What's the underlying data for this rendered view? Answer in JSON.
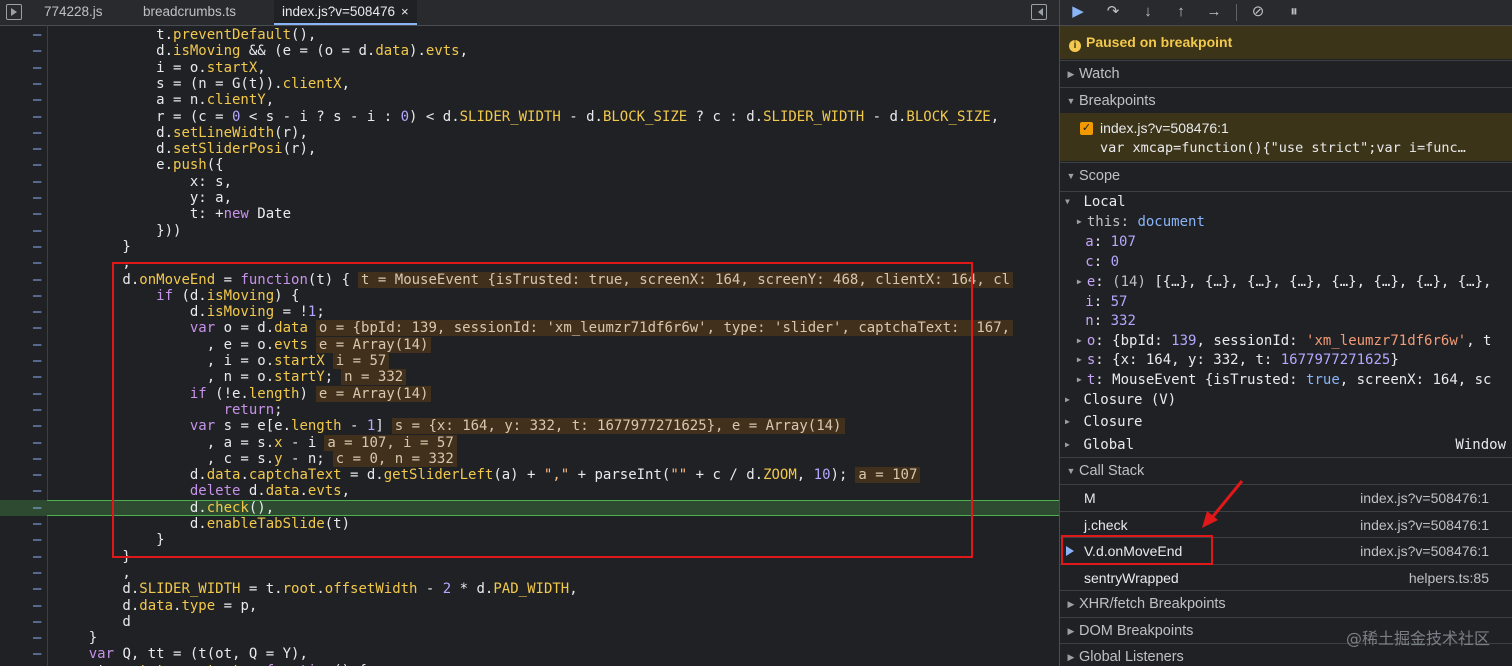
{
  "tabs": [
    {
      "label": "774228.js",
      "active": false
    },
    {
      "label": "breadcrumbs.ts",
      "active": false
    },
    {
      "label": "index.js?v=508476",
      "active": true
    }
  ],
  "tab_close": "×",
  "code_lines": [
    {
      "t": "            t.preventDefault(),"
    },
    {
      "t": "            d.isMoving && (e = (o = d.data).evts,"
    },
    {
      "t": "            i = o.startX,"
    },
    {
      "t": "            s = (n = G(t)).clientX,"
    },
    {
      "t": "            a = n.clientY,"
    },
    {
      "t": "            r = (c = 0 < s - i ? s - i : 0) < d.SLIDER_WIDTH - d.BLOCK_SIZE ? c : d.SLIDER_WIDTH - d.BLOCK_SIZE,"
    },
    {
      "t": "            d.setLineWidth(r),"
    },
    {
      "t": "            d.setSliderPosi(r),"
    },
    {
      "t": "            e.push({"
    },
    {
      "t": "                x: s,"
    },
    {
      "t": "                y: a,"
    },
    {
      "t": "                t: +new Date"
    },
    {
      "t": "            }))"
    },
    {
      "t": "        }"
    },
    {
      "t": "        ,"
    },
    {
      "t": "        d.onMoveEnd = function(t) {",
      "i": "t = MouseEvent {isTrusted: true, screenX: 164, screenY: 468, clientX: 164, cl"
    },
    {
      "t": "            if (d.isMoving) {"
    },
    {
      "t": "                d.isMoving = !1;"
    },
    {
      "t": "                var o = d.data",
      "i": "o = {bpId: 139, sessionId: 'xm_leumzr71df6r6w', type: 'slider', captchaText: '167,"
    },
    {
      "t": "                  , e = o.evts",
      "i": "e = Array(14)"
    },
    {
      "t": "                  , i = o.startX",
      "i": "i = 57"
    },
    {
      "t": "                  , n = o.startY;",
      "i": "n = 332"
    },
    {
      "t": "                if (!e.length)",
      "i": "e = Array(14)"
    },
    {
      "t": "                    return;"
    },
    {
      "t": "                var s = e[e.length - 1]",
      "i": "s = {x: 164, y: 332, t: 1677977271625}, e = Array(14)"
    },
    {
      "t": "                  , a = s.x - i",
      "i": "a = 107, i = 57"
    },
    {
      "t": "                  , c = s.y - n;",
      "i": "c = 0, n = 332"
    },
    {
      "t": "                d.data.captchaText = d.getSliderLeft(a) + \",\" + parseInt(\"\" + c / d.ZOOM, 10);",
      "i": "a = 107"
    },
    {
      "t": "                delete d.data.evts,"
    },
    {
      "t": "                d.check(),",
      "hl": true
    },
    {
      "t": "                d.enableTabSlide(t)"
    },
    {
      "t": "            }"
    },
    {
      "t": "        }"
    },
    {
      "t": "        ,"
    },
    {
      "t": "        d.SLIDER_WIDTH = t.root.offsetWidth - 2 * d.PAD_WIDTH,"
    },
    {
      "t": "        d.data.type = p,"
    },
    {
      "t": "        d"
    },
    {
      "t": "    }"
    },
    {
      "t": "    var Q, tt = (t(ot, Q = Y),"
    },
    {
      "t": "    ot.prototype.start = function() {"
    }
  ],
  "gutter_mark": "–",
  "debugger": {
    "paused_label": "Paused on breakpoint",
    "sections": {
      "watch": "Watch",
      "breakpoints": "Breakpoints",
      "scope": "Scope",
      "call_stack": "Call Stack",
      "xhr": "XHR/fetch Breakpoints",
      "dom": "DOM Breakpoints",
      "global_listeners": "Global Listeners"
    },
    "breakpoint": {
      "checked": true,
      "file": "index.js?v=508476:1",
      "code": "var xmcap=function(){\"use strict\";var i=func…"
    },
    "scope": {
      "local_label": "Local",
      "this_key": "this",
      "this_val": "document",
      "a_val": "107",
      "c_val": "0",
      "e_count": "(14)",
      "e_val": "[{…}, {…}, {…}, {…}, {…}, {…}, {…}, {…},",
      "i_val": "57",
      "n_val": "332",
      "o_head": "{bpId: ",
      "o_num": "139",
      "o_mid": ", sessionId: ",
      "o_str": "'xm_leumzr71df6r6w'",
      "o_tail": ", t",
      "s_head": "{x: 164, y: 332, t: ",
      "s_num": "1677977271625",
      "s_tail": "}",
      "t_head": "MouseEvent {isTrusted: ",
      "t_bool": "true",
      "t_tail": ", screenX: 164, sc",
      "closure1": "Closure (V)",
      "closure2": "Closure",
      "global": "Global",
      "global_val": "Window"
    },
    "call_stack": [
      {
        "fn": "M",
        "loc": "index.js?v=508476:1",
        "current": false
      },
      {
        "fn": "j.check",
        "loc": "index.js?v=508476:1",
        "current": false
      },
      {
        "fn": "V.d.onMoveEnd",
        "loc": "index.js?v=508476:1",
        "current": true
      },
      {
        "fn": "sentryWrapped",
        "loc": "helpers.ts:85",
        "current": false
      }
    ]
  },
  "watermark": "@稀土掘金技术社区",
  "colors": {
    "accent": "#8ab4f8",
    "paused_bg": "#3c3418",
    "annotation_red": "#e0181a",
    "current_line": "#2e4b31"
  }
}
